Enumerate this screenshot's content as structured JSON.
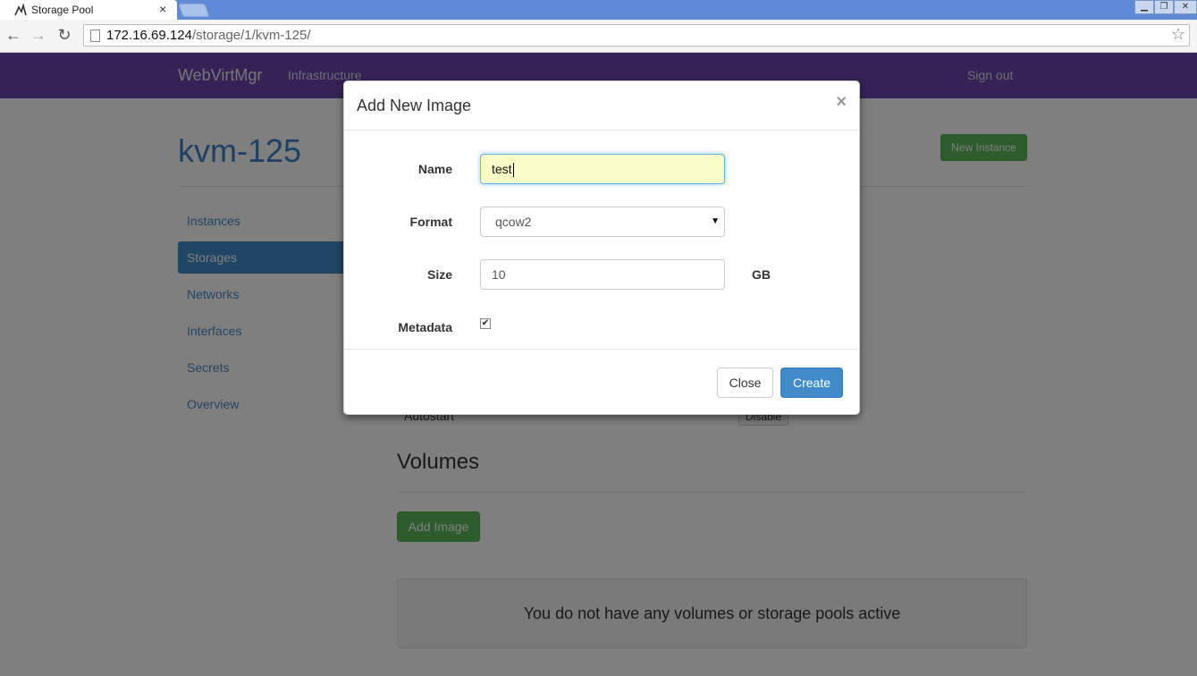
{
  "browser": {
    "tab_title": "Storage Pool",
    "tab_close": "×",
    "url_host": "172.16.69.124",
    "url_path": "/storage/1/kvm-125/",
    "icons": [
      "back-icon",
      "forward-icon",
      "reload-icon",
      "star-icon"
    ]
  },
  "navbar": {
    "brand": "WebVirtMgr",
    "link": "Infrastructure",
    "signout": "Sign out"
  },
  "page": {
    "host_title": "kvm-125",
    "new_instance_label": "New Instance",
    "sidenav": [
      {
        "label": "Instances",
        "active": false
      },
      {
        "label": "Storages",
        "active": true
      },
      {
        "label": "Networks",
        "active": false
      },
      {
        "label": "Interfaces",
        "active": false
      },
      {
        "label": "Secrets",
        "active": false
      },
      {
        "label": "Overview",
        "active": false
      }
    ],
    "autostart_label": "Autostart",
    "disable_label": "Disable",
    "volumes_title": "Volumes",
    "add_image_label": "Add Image",
    "empty_message": "You do not have any volumes or storage pools active"
  },
  "modal": {
    "title": "Add New Image",
    "close_symbol": "×",
    "fields": {
      "name_label": "Name",
      "name_value": "test",
      "format_label": "Format",
      "format_value": "qcow2",
      "size_label": "Size",
      "size_value": "10",
      "size_unit": "GB",
      "metadata_label": "Metadata",
      "metadata_checked": true
    },
    "close_button": "Close",
    "create_button": "Create"
  },
  "colors": {
    "navbar": "#6a46b0",
    "primary": "#428bca",
    "success": "#5cb85c"
  }
}
